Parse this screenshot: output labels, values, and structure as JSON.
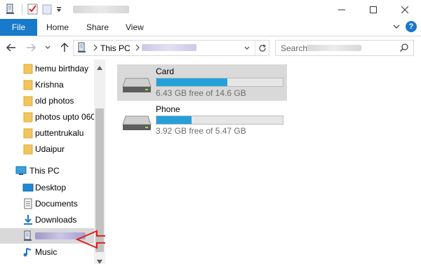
{
  "titlebar": {
    "icons": [
      "this-pc-icon",
      "properties-check-icon",
      "new-folder-icon",
      "customize-dropdown-icon"
    ],
    "window_controls": [
      "minimize-icon",
      "maximize-icon",
      "close-icon"
    ]
  },
  "ribbon": {
    "file_label": "File",
    "tabs": [
      {
        "label": "Home"
      },
      {
        "label": "Share"
      },
      {
        "label": "View"
      }
    ],
    "help_label": "?"
  },
  "navbar": {
    "address_label": "This PC",
    "search_placeholder": "Search"
  },
  "sidebar": {
    "items": [
      {
        "label": "hemu birthday",
        "icon": "folder-icon"
      },
      {
        "label": "Krishna",
        "icon": "folder-icon"
      },
      {
        "label": "old photos",
        "icon": "folder-icon"
      },
      {
        "label": "photos upto 060",
        "icon": "folder-icon"
      },
      {
        "label": "puttentrukalu",
        "icon": "folder-icon"
      },
      {
        "label": "Udaipur",
        "icon": "folder-icon"
      },
      {
        "label": "This PC",
        "icon": "this-pc-icon"
      },
      {
        "label": "Desktop",
        "icon": "desktop-icon"
      },
      {
        "label": "Documents",
        "icon": "documents-icon"
      },
      {
        "label": "Downloads",
        "icon": "downloads-icon"
      },
      {
        "label": "",
        "icon": "device-icon",
        "selected": true
      },
      {
        "label": "Music",
        "icon": "music-icon"
      }
    ]
  },
  "drives": [
    {
      "name": "Card",
      "free": "6.43 GB free of 14.6 GB",
      "used_fraction": 0.56,
      "selected": true
    },
    {
      "name": "Phone",
      "free": "3.92 GB free of 5.47 GB",
      "used_fraction": 0.28,
      "selected": false
    }
  ],
  "colors": {
    "accent": "#1979ca",
    "capacity_fill": "#26a0da",
    "folder": "#f2c55c",
    "annotation_arrow": "#e0201c",
    "selection": "#d9d9d9"
  }
}
